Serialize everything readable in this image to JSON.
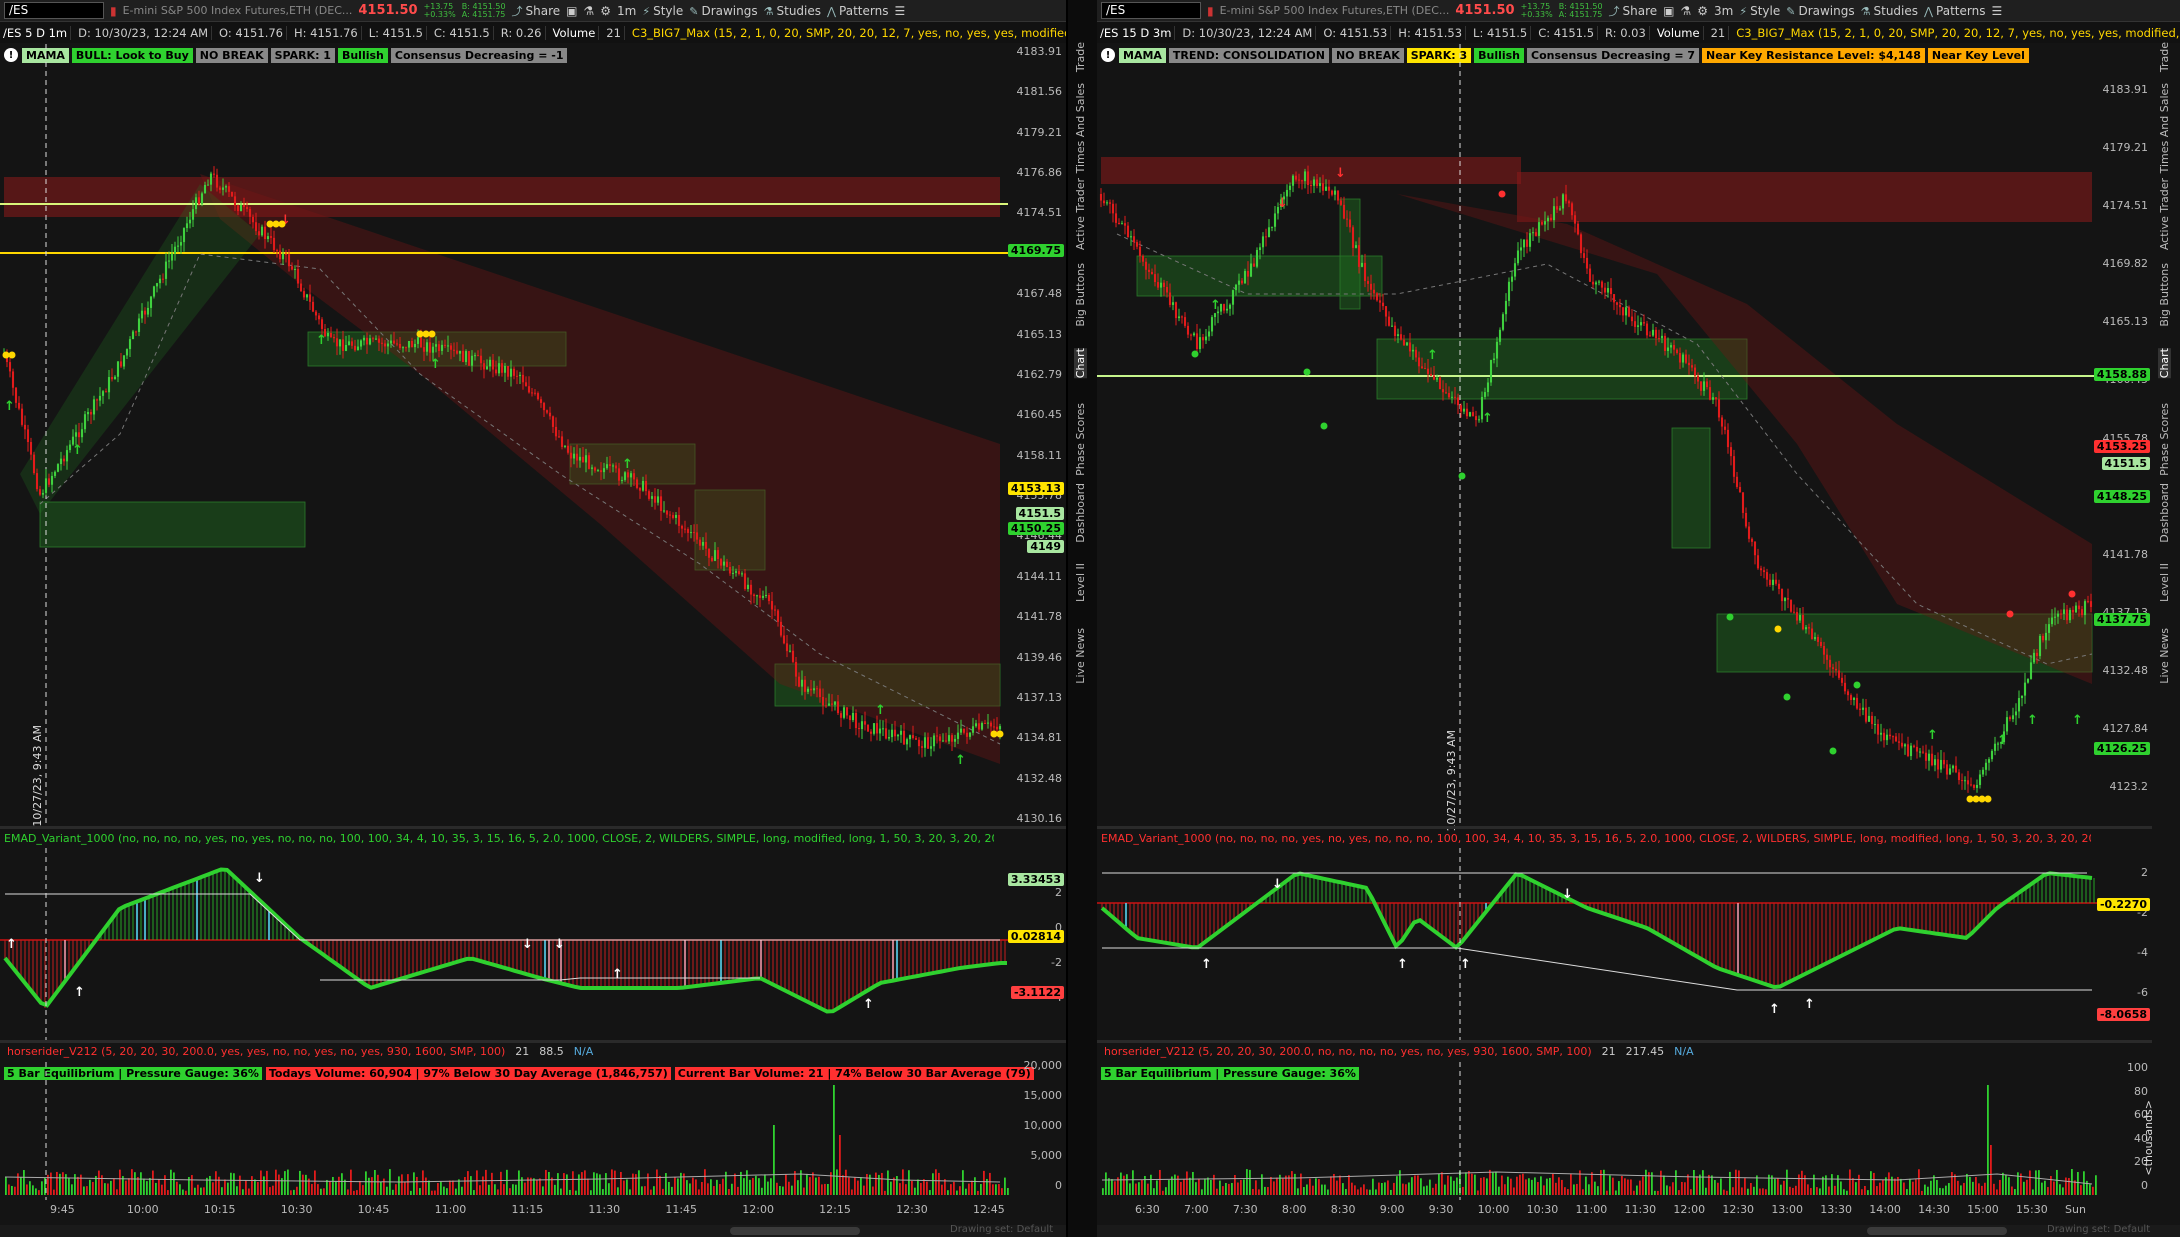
{
  "left": {
    "toolbar": {
      "symbol": "/ES",
      "description": "E-mini S&P 500 Index Futures,ETH (DEC...",
      "last": "4151.50",
      "change": "+13.75",
      "change_pct": "+0.33%",
      "bid": "B: 4151.50",
      "ask": "A: 4151.75",
      "share": "Share",
      "interval": "1m",
      "style": "Style",
      "drawings": "Drawings",
      "studies": "Studies",
      "patterns": "Patterns"
    },
    "infobar": {
      "symbol_tf": "/ES 5 D 1m",
      "date": "D: 10/30/23, 12:24 AM",
      "open": "O: 4151.76",
      "high": "H: 4151.76",
      "low": "L: 4151.5",
      "close": "C: 4151.5",
      "range": "R: 0.26",
      "volume_label": "Volume",
      "volume_val": "21",
      "study": "C3_BIG7_Max (15, 2, 1, 0, 20, SMP, 20, 20, 12, 7, yes, no, yes, yes, modified, SIMPLE,..."
    },
    "labels": [
      "MAMA",
      "BULL: Look to Buy",
      "NO BREAK",
      "SPARK: 1",
      "Bullish",
      "Consensus Decreasing = -1"
    ],
    "price_ticks": [
      "4183.91",
      "4181.56",
      "4179.21",
      "4176.86",
      "4174.51",
      "4172.16",
      "4167.48",
      "4165.13",
      "4162.79",
      "4160.45",
      "4158.11",
      "4155.78",
      "4146.44",
      "4144.11",
      "4141.78",
      "4139.46",
      "4137.13",
      "4134.81",
      "4132.48",
      "4130.16"
    ],
    "price_tags": [
      {
        "text": "4169.75",
        "color": "#2fd12f"
      },
      {
        "text": "4153.13",
        "color": "#ffe500"
      },
      {
        "text": "4151.5",
        "color": "#a8e6a0"
      },
      {
        "text": "4150.25",
        "color": "#2fd12f"
      },
      {
        "text": "4149",
        "color": "#a8e6a0"
      }
    ],
    "date_marker": "10/27/23, 9:43 AM",
    "emad_title": "EMAD_Variant_1000 (no, no, no, no, yes, no, yes, no, no, no, 100, 100, 34, 4, 10, 35, 3, 15, 16, 5, 2.0, 1000, CLOSE, 2, WILDERS, SIMPLE, long, modified, long, 1, 50, 3, 20, 3, 20, 20, 1, 10, 20, 1, 1,...",
    "emad_ticks": [
      "2",
      "0",
      "-2",
      "-4"
    ],
    "emad_tags": [
      {
        "text": "3.33453",
        "color": "#a8e6a0"
      },
      {
        "text": "0.02814",
        "color": "#ffe500"
      },
      {
        "text": "-3.1122",
        "color": "#ff4040"
      }
    ],
    "vol_title": "horserider_V212 (5, 20, 20, 30, 200.0, yes, yes, no, no, yes, no, yes, 930, 1600, SMP, 100)",
    "vol_vals": [
      "21",
      "88.5",
      "N/A"
    ],
    "vol_labels": [
      {
        "text": "5 Bar Equilibrium | Pressure Gauge: 36%",
        "color": "#2fd12f"
      },
      {
        "text": "Todays Volume: 60,904 | 97% Below 30 Day Average (1,846,757)",
        "color": "#ff3030"
      },
      {
        "text": "Current Bar Volume: 21 | 74% Below 30 Bar Average (79)",
        "color": "#ff3030"
      }
    ],
    "vol_ticks": [
      "20,000",
      "15,000",
      "10,000",
      "5,000",
      "0"
    ],
    "time_ticks": [
      "9:45",
      "10:00",
      "10:15",
      "10:30",
      "10:45",
      "11:00",
      "11:15",
      "11:30",
      "11:45",
      "12:00",
      "12:15",
      "12:30",
      "12:45"
    ],
    "drawing_hint": "Drawing set: Default",
    "vtabs": [
      "Trade",
      "Times And Sales",
      "Active Trader",
      "Big Buttons",
      "Chart",
      "Phase Scores",
      "Dashboard",
      "Level II",
      "Live News"
    ]
  },
  "right": {
    "toolbar": {
      "symbol": "/ES",
      "description": "E-mini S&P 500 Index Futures,ETH (DEC...",
      "last": "4151.50",
      "change": "+13.75",
      "change_pct": "+0.33%",
      "bid": "B: 4151.50",
      "ask": "A: 4151.75",
      "share": "Share",
      "interval": "3m",
      "style": "Style",
      "drawings": "Drawings",
      "studies": "Studies",
      "patterns": "Patterns"
    },
    "infobar": {
      "symbol_tf": "/ES 15 D 3m",
      "date": "D: 10/30/23, 12:24 AM",
      "open": "O: 4151.53",
      "high": "H: 4151.53",
      "low": "L: 4151.5",
      "close": "C: 4151.5",
      "range": "R: 0.03",
      "volume_label": "Volume",
      "volume_val": "21",
      "study": "C3_BIG7_Max (15, 2, 1, 0, 20, SMP, 20, 20, 12, 7, yes, no, yes, yes, modified, SIMPLE,..."
    },
    "labels": [
      "MAMA",
      "TREND: CONSOLIDATION",
      "NO BREAK",
      "SPARK: 3",
      "Bullish",
      "Consensus Decreasing = 7",
      "Near Key Resistance Level: $4,148",
      "Near Key Level"
    ],
    "price_ticks": [
      "4183.91",
      "4179.21",
      "4174.51",
      "4169.82",
      "4165.13",
      "4160.45",
      "4155.78",
      "4146.44",
      "4141.78",
      "4137.13",
      "4132.48",
      "4127.84",
      "4123.2"
    ],
    "price_tags": [
      {
        "text": "4158.88",
        "color": "#2fd12f"
      },
      {
        "text": "4153.25",
        "color": "#ff3030"
      },
      {
        "text": "4151.5",
        "color": "#a8e6a0"
      },
      {
        "text": "4148.25",
        "color": "#2fd12f"
      },
      {
        "text": "4137.75",
        "color": "#2fd12f"
      },
      {
        "text": "4126.25",
        "color": "#2fd12f"
      }
    ],
    "date_marker": "10/27/23, 9:43 AM",
    "emad_title": "EMAD_Variant_1000 (no, no, no, no, yes, no, yes, no, no, no, 100, 100, 34, 4, 10, 35, 3, 15, 16, 5, 2.0, 1000, CLOSE, 2, WILDERS, SIMPLE, long, modified, long, 1, 50, 3, 20, 3, 20, 20, 1, 10, 20, 1, 1,...",
    "emad_ticks": [
      "2",
      "-2",
      "-4",
      "-6"
    ],
    "emad_tags": [
      {
        "text": "-0.2270",
        "color": "#ffe500"
      },
      {
        "text": "-8.0658",
        "color": "#ff4040"
      }
    ],
    "vol_title": "horserider_V212 (5, 20, 20, 30, 200.0, no, no, no, no, yes, no, yes, 930, 1600, SMP, 100)",
    "vol_vals": [
      "21",
      "217.45",
      "N/A"
    ],
    "vol_labels": [
      {
        "text": "5 Bar Equilibrium | Pressure Gauge: 36%",
        "color": "#2fd12f"
      }
    ],
    "vol_ticks": [
      "100",
      "80",
      "60",
      "40",
      "20",
      "0"
    ],
    "vol_unit": "<thousands>",
    "time_ticks": [
      "6:30",
      "7:00",
      "7:30",
      "8:00",
      "8:30",
      "9:00",
      "9:30",
      "10:00",
      "10:30",
      "11:00",
      "11:30",
      "12:00",
      "12:30",
      "13:00",
      "13:30",
      "14:00",
      "14:30",
      "15:00",
      "15:30",
      "Sun"
    ],
    "drawing_hint": "Drawing set: Default",
    "vtabs": [
      "Trade",
      "Times And Sales",
      "Active Trader",
      "Big Buttons",
      "Chart",
      "Phase Scores",
      "Dashboard",
      "Level II",
      "Live News"
    ]
  },
  "colors": {
    "bull": "#2fd12f",
    "bear": "#ff2020",
    "bg": "#141414",
    "accent": "#ffe500"
  }
}
